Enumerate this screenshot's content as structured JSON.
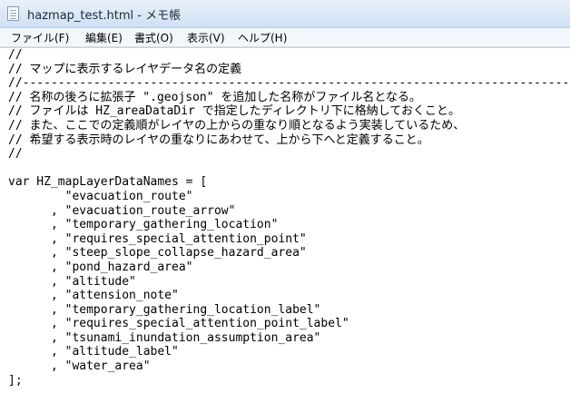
{
  "window": {
    "title": "hazmap_test.html - メモ帳"
  },
  "menu": {
    "items": [
      "ファイル(F)",
      "編集(E)",
      "書式(O)",
      "表示(V)",
      "ヘルプ(H)"
    ]
  },
  "editor": {
    "lines": [
      "//",
      "// マップに表示するレイヤデータ名の定義",
      "//------------------------------------------------------------------------------",
      "// 名称の後ろに拡張子 \".geojson\" を追加した名称がファイル名となる。",
      "// ファイルは HZ_areaDataDir で指定したディレクトリ下に格納しておくこと。",
      "// また、ここでの定義順がレイヤの上からの重なり順となるよう実装しているため、",
      "// 希望する表示時のレイヤの重なりにあわせて、上から下へと定義すること。",
      "//",
      "",
      "var HZ_mapLayerDataNames = [",
      "        \"evacuation_route\"",
      "      , \"evacuation_route_arrow\"",
      "      , \"temporary_gathering_location\"",
      "      , \"requires_special_attention_point\"",
      "      , \"steep_slope_collapse_hazard_area\"",
      "      , \"pond_hazard_area\"",
      "      , \"altitude\"",
      "      , \"attension_note\"",
      "      , \"temporary_gathering_location_label\"",
      "      , \"requires_special_attention_point_label\"",
      "      , \"tsunami_inundation_assumption_area\"",
      "      , \"altitude_label\"",
      "      , \"water_area\"",
      "];"
    ]
  }
}
